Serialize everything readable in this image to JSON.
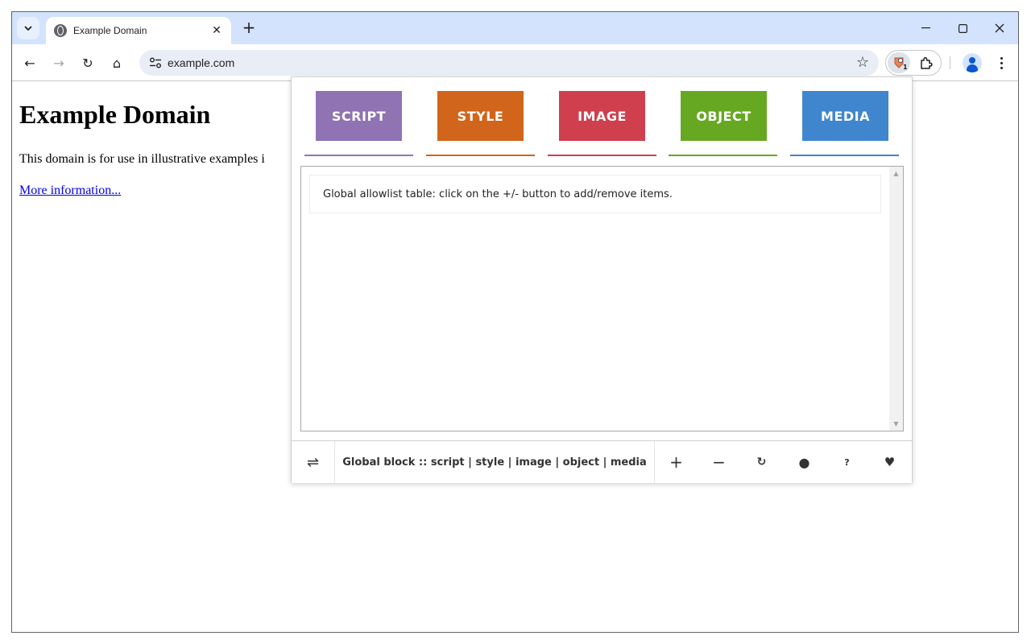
{
  "browser": {
    "tab": {
      "title": "Example Domain",
      "close_glyph": "✕"
    },
    "new_tab_glyph": "+",
    "window_controls": {
      "minimize": "—",
      "maximize": "☐",
      "close": "✕"
    },
    "nav": {
      "back": "←",
      "forward": "→",
      "reload": "↻",
      "home": "⌂"
    },
    "address": {
      "url": "example.com",
      "bookmark_glyph": "☆"
    },
    "extension_badge": "1"
  },
  "page": {
    "heading": "Example Domain",
    "paragraph": "This domain is for use in illustrative examples i",
    "link": "More information..."
  },
  "popup": {
    "categories": [
      {
        "label": "SCRIPT",
        "color": "#9073b3"
      },
      {
        "label": "STYLE",
        "color": "#d0651b"
      },
      {
        "label": "IMAGE",
        "color": "#cf3f4d"
      },
      {
        "label": "OBJECT",
        "color": "#67a823"
      },
      {
        "label": "MEDIA",
        "color": "#3f86ce"
      }
    ],
    "hint": "Global allowlist table: click on the +/- button to add/remove items.",
    "bottom": {
      "swap_glyph": "⇌",
      "status": "Global block :: script | style | image | object | media",
      "buttons": [
        {
          "name": "add-button",
          "glyph": "+"
        },
        {
          "name": "remove-button",
          "glyph": "−"
        },
        {
          "name": "refresh-button",
          "glyph": "↻"
        },
        {
          "name": "toggle-button",
          "glyph": "●"
        },
        {
          "name": "help-button",
          "glyph": "?"
        },
        {
          "name": "donate-button",
          "glyph": "♥"
        }
      ]
    }
  }
}
